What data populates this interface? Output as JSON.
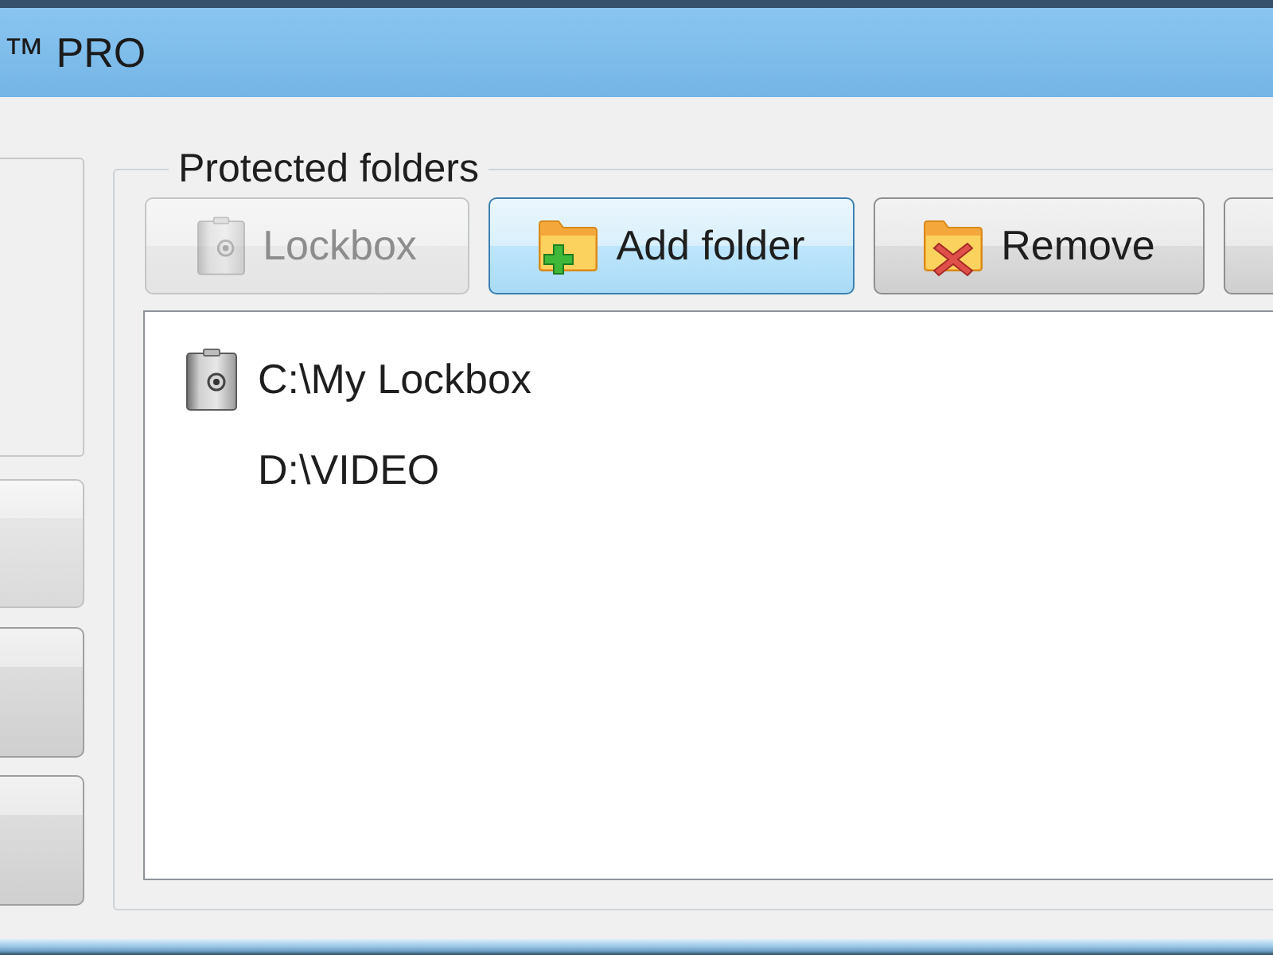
{
  "window": {
    "title": "™ PRO"
  },
  "protected_folders": {
    "title": "Protected folders",
    "buttons": [
      {
        "kind": "lockbox",
        "label": "Lockbox",
        "disabled": true,
        "highlighted": false
      },
      {
        "kind": "add",
        "label": "Add folder",
        "disabled": false,
        "highlighted": true
      },
      {
        "kind": "remove",
        "label": "Remove",
        "disabled": false,
        "highlighted": false
      },
      {
        "kind": "blank",
        "disabled": false,
        "highlighted": false
      }
    ],
    "folders": [
      {
        "kind": "lockbox",
        "path": "C:\\My Lockbox"
      },
      {
        "kind": "plain",
        "path": "D:\\VIDEO"
      }
    ]
  }
}
